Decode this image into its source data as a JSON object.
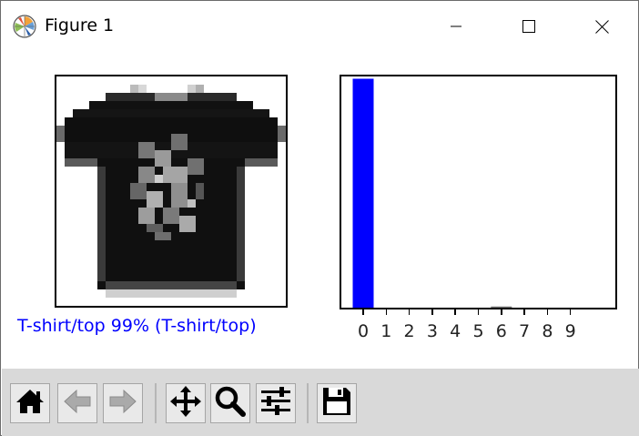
{
  "window": {
    "title": "Figure 1",
    "icons": [
      "matplotlib-icon",
      "minimize-icon",
      "maximize-icon",
      "close-icon"
    ]
  },
  "figure": {
    "image_label": "T-shirt/top 99% (T-shirt/top)",
    "image_label_color": "#0000ff"
  },
  "chart_data": {
    "type": "bar",
    "categories": [
      "0",
      "1",
      "2",
      "3",
      "4",
      "5",
      "6",
      "7",
      "8",
      "9"
    ],
    "values": [
      0.99,
      0.0,
      0.0,
      0.0,
      0.0,
      0.0,
      0.005,
      0.0,
      0.0,
      0.0
    ],
    "ylim": [
      0,
      1
    ],
    "bar_color": "#0000ff",
    "highlight_color": "#0000ff",
    "grid": false
  },
  "toolbar": {
    "buttons": [
      {
        "name": "home-button",
        "icon": "home-icon"
      },
      {
        "name": "back-button",
        "icon": "arrow-left-icon"
      },
      {
        "name": "forward-button",
        "icon": "arrow-right-icon"
      },
      {
        "name": "pan-button",
        "icon": "move-icon"
      },
      {
        "name": "zoom-button",
        "icon": "magnifier-icon"
      },
      {
        "name": "configure-subplots-button",
        "icon": "sliders-icon"
      },
      {
        "name": "save-button",
        "icon": "floppy-disk-icon"
      }
    ]
  }
}
